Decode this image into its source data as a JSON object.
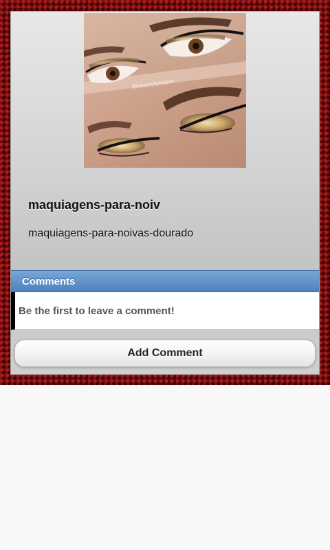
{
  "post": {
    "title": "maquiagens-para-noiv",
    "description": "maquiagens-para-noivas-dourado",
    "image": {
      "alt": "Close-up eye makeup with gold glitter eyeshadow and black winged eyeliner",
      "watermark": "@beautybybazan"
    }
  },
  "comments": {
    "header": "Comments",
    "empty_message": "Be the first to leave a comment!"
  },
  "actions": {
    "add_comment_label": "Add Comment"
  },
  "colors": {
    "frame": "#7a0c0c",
    "comments_header": "#5b8ec9",
    "panel": "#d2d2d2"
  }
}
